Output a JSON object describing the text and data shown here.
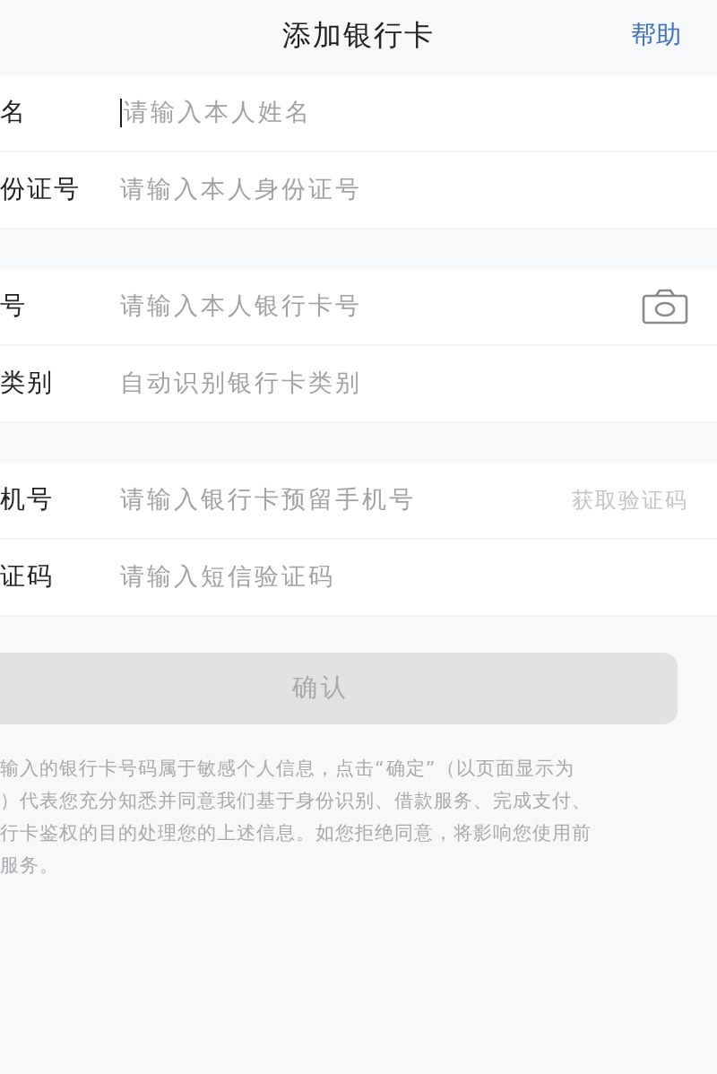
{
  "header": {
    "title": "添加银行卡",
    "help": "帮助"
  },
  "groups": [
    {
      "fields": [
        {
          "label": "名",
          "placeholder": "请输入本人姓名",
          "focused": true
        },
        {
          "label": "份证号",
          "placeholder": "请输入本人身份证号",
          "focused": false
        }
      ]
    },
    {
      "fields": [
        {
          "label": "号",
          "placeholder": "请输入本人银行卡号",
          "focused": false,
          "kind": "camera"
        },
        {
          "label": "类别",
          "placeholder": "自动识别银行卡类别",
          "focused": false
        }
      ]
    },
    {
      "fields": [
        {
          "label": "机号",
          "placeholder": "请输入银行卡预留手机号",
          "focused": false,
          "kind": "code",
          "action": "获取验证码"
        },
        {
          "label": "证码",
          "placeholder": "请输入短信验证码",
          "focused": false
        }
      ]
    }
  ],
  "confirm": {
    "label": "确认",
    "disabled": true
  },
  "notice": [
    "输入的银行卡号码属于敏感个人信息，点击“确定”（以页面显示为",
    "）代表您充分知悉并同意我们基于身份识别、借款服务、完成支付、",
    "行卡鉴权的目的处理您的上述信息。如您拒绝同意，将影响您使用前",
    "服务。"
  ]
}
